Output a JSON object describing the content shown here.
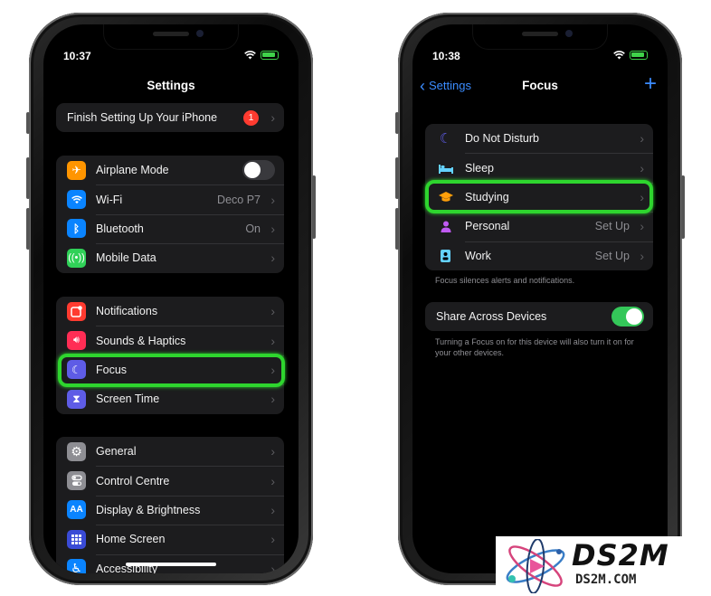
{
  "left_phone": {
    "time": "10:37",
    "title": "Settings",
    "setup_row": {
      "label": "Finish Setting Up Your iPhone",
      "badge": "1"
    },
    "group1": [
      {
        "label": "Airplane Mode",
        "icon": "airplane-icon",
        "color": "#ff9500"
      },
      {
        "label": "Wi-Fi",
        "value": "Deco P7",
        "icon": "wifi-icon",
        "color": "#0a84ff"
      },
      {
        "label": "Bluetooth",
        "value": "On",
        "icon": "bluetooth-icon",
        "color": "#0a84ff"
      },
      {
        "label": "Mobile Data",
        "icon": "antenna-icon",
        "color": "#30d158"
      }
    ],
    "group2": [
      {
        "label": "Notifications",
        "icon": "notifications-icon",
        "color": "#ff3b30"
      },
      {
        "label": "Sounds & Haptics",
        "icon": "speaker-icon",
        "color": "#ff2d55"
      },
      {
        "label": "Focus",
        "icon": "moon-icon",
        "color": "#5e5ce6"
      },
      {
        "label": "Screen Time",
        "icon": "hourglass-icon",
        "color": "#5e5ce6"
      }
    ],
    "group3": [
      {
        "label": "General",
        "icon": "gear-icon",
        "color": "#8e8e93"
      },
      {
        "label": "Control Centre",
        "icon": "toggles-icon",
        "color": "#8e8e93"
      },
      {
        "label": "Display & Brightness",
        "icon": "text-size-icon",
        "color": "#0a84ff",
        "glyph": "AA"
      },
      {
        "label": "Home Screen",
        "icon": "grid-icon",
        "color": "#3a4bd6"
      },
      {
        "label": "Accessibility",
        "icon": "accessibility-icon",
        "color": "#0a84ff"
      }
    ]
  },
  "right_phone": {
    "time": "10:38",
    "back_label": "Settings",
    "title": "Focus",
    "add_glyph": "+",
    "focus_modes": [
      {
        "label": "Do Not Disturb",
        "icon": "moon-icon",
        "color": "#5e5ce6"
      },
      {
        "label": "Sleep",
        "icon": "bed-icon",
        "color": "#64d2ff"
      },
      {
        "label": "Studying",
        "icon": "graduation-cap-icon",
        "color": "#ff9f0a"
      },
      {
        "label": "Personal",
        "value": "Set Up",
        "icon": "person-icon",
        "color": "#bf5af2"
      },
      {
        "label": "Work",
        "value": "Set Up",
        "icon": "badge-icon",
        "color": "#64d2ff"
      }
    ],
    "focus_footnote": "Focus silences alerts and notifications.",
    "share_label": "Share Across Devices",
    "share_on": true,
    "share_footnote": "Turning a Focus on for this device will also turn it on for your other devices."
  },
  "watermark": {
    "title": "DS2M",
    "subtitle": "DS2M.COM"
  },
  "accent_colors": {
    "highlight": "#2ed52e",
    "link": "#3b8cff",
    "toggle_on": "#34c759"
  }
}
